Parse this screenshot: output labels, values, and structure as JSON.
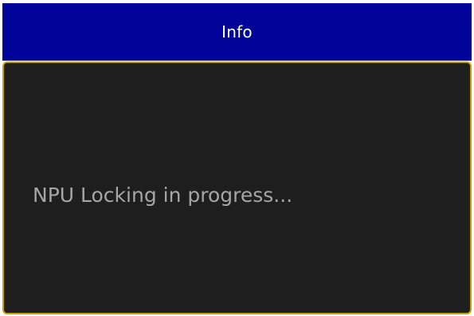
{
  "dialog": {
    "title": "Info",
    "message": "NPU Locking in progress...",
    "colors": {
      "titlebar_bg": "#020399",
      "titlebar_text": "#ffffff",
      "content_bg": "#1e1e1e",
      "border_accent": "#c8a000",
      "message_text": "#a6a6a6"
    }
  }
}
